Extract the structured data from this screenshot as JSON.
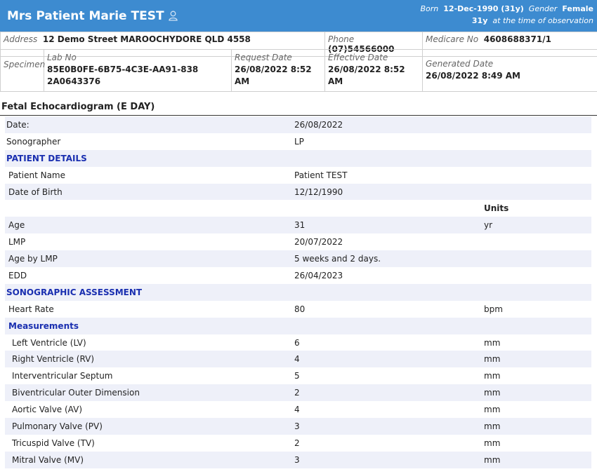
{
  "header": {
    "name": "Mrs Patient Marie TEST",
    "born_label": "Born",
    "born_value": "12-Dec-1990 (31y)",
    "gender_label": "Gender",
    "gender_value": "Female",
    "age_value": "31y",
    "age_note": "at the time of observation"
  },
  "info": {
    "address_label": "Address",
    "address_value": "12 Demo Street MAROOCHYDORE QLD 4558",
    "phone_label": "Phone",
    "phone_value": "(07)54566000",
    "medicare_label": "Medicare No",
    "medicare_value": "4608688371/1",
    "specimen_label": "Specimen",
    "labno_label": "Lab No",
    "labno_value": "85E0B0FE-6B75-4C3E-AA91-8382A0643376",
    "request_label": "Request Date",
    "request_value": "26/08/2022 8:52 AM",
    "effective_label": "Effective Date",
    "effective_value": "26/08/2022 8:52 AM",
    "generated_label": "Generated Date",
    "generated_value": "26/08/2022 8:49 AM"
  },
  "report": {
    "title": "Fetal Echocardiogram (E DAY)",
    "rows": [
      {
        "label": "Date:",
        "value": "26/08/2022",
        "unit": "",
        "kind": "plain"
      },
      {
        "label": "Sonographer",
        "value": "LP",
        "unit": "",
        "kind": "plain"
      },
      {
        "label": "PATIENT DETAILS",
        "value": "",
        "unit": "",
        "kind": "section"
      },
      {
        "label": "Patient Name",
        "value": "Patient TEST",
        "unit": "",
        "kind": "sub"
      },
      {
        "label": "Date of Birth",
        "value": "12/12/1990",
        "unit": "",
        "kind": "sub"
      },
      {
        "label": "",
        "value": "",
        "unit": "Units",
        "kind": "units"
      },
      {
        "label": "Age",
        "value": "31",
        "unit": "yr",
        "kind": "sub"
      },
      {
        "label": "LMP",
        "value": "20/07/2022",
        "unit": "",
        "kind": "sub"
      },
      {
        "label": "Age by LMP",
        "value": "5 weeks and 2 days.",
        "unit": "",
        "kind": "sub"
      },
      {
        "label": "EDD",
        "value": "26/04/2023",
        "unit": "",
        "kind": "sub"
      },
      {
        "label": "SONOGRAPHIC ASSESSMENT",
        "value": "",
        "unit": "",
        "kind": "section"
      },
      {
        "label": "Heart Rate",
        "value": "80",
        "unit": "bpm",
        "kind": "sub"
      },
      {
        "label": "Measurements",
        "value": "",
        "unit": "",
        "kind": "subsection"
      },
      {
        "label": "Left Ventricle (LV)",
        "value": "6",
        "unit": "mm",
        "kind": "sub2"
      },
      {
        "label": "Right Ventricle (RV)",
        "value": "4",
        "unit": "mm",
        "kind": "sub2"
      },
      {
        "label": "Interventricular Septum",
        "value": "5",
        "unit": "mm",
        "kind": "sub2"
      },
      {
        "label": "Biventricular Outer Dimension",
        "value": "2",
        "unit": "mm",
        "kind": "sub2"
      },
      {
        "label": "Aortic Valve (AV)",
        "value": "4",
        "unit": "mm",
        "kind": "sub2"
      },
      {
        "label": "Pulmonary Valve (PV)",
        "value": "3",
        "unit": "mm",
        "kind": "sub2"
      },
      {
        "label": "Tricuspid Valve (TV)",
        "value": "2",
        "unit": "mm",
        "kind": "sub2"
      },
      {
        "label": "Mitral Valve (MV)",
        "value": "3",
        "unit": "mm",
        "kind": "sub2"
      }
    ]
  }
}
